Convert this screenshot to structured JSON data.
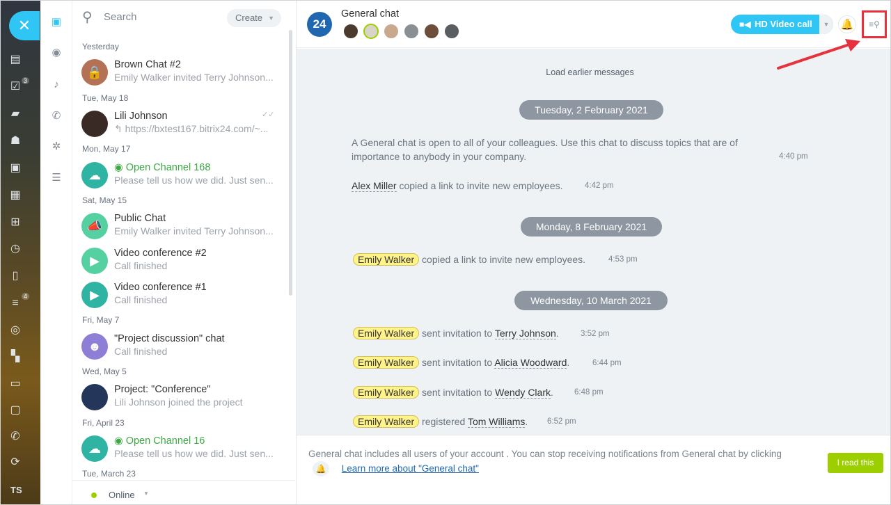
{
  "rail": {
    "close_glyph": "✕",
    "icons": [
      "feed-icon",
      "tasks-icon",
      "chat-icon",
      "employees-icon",
      "crm-icon",
      "calendar-icon",
      "shop-icon",
      "time-icon",
      "documents-icon",
      "filter-icon",
      "goals-icon",
      "apps-icon",
      "printer-icon",
      "window-icon",
      "phone-icon",
      "sync-icon"
    ],
    "badges": {
      "tasks": "3",
      "filter": "4"
    },
    "user_initials": "TS"
  },
  "iconcol": [
    "messages-icon",
    "openlines-icon",
    "notifications-icon",
    "calls-icon",
    "settings-icon",
    "tasks-list-icon"
  ],
  "search": {
    "placeholder": "Search",
    "create_label": "Create"
  },
  "recent": {
    "groups": [
      {
        "date": "Yesterday",
        "items": [
          {
            "title": "Brown Chat #2",
            "sub": "Emily Walker invited Terry Johnson..."
          }
        ]
      },
      {
        "date": "Tue, May 18",
        "items": [
          {
            "title": "Lili Johnson",
            "sub": "↰ https://bxtest167.bitrix24.com/~..."
          }
        ]
      },
      {
        "date": "Mon, May 17",
        "items": [
          {
            "title": "Open Channel 168",
            "sub": "Please tell us how we did. Just sen..."
          }
        ]
      },
      {
        "date": "Sat, May 15",
        "items": [
          {
            "title": "Public Chat",
            "sub": "Emily Walker invited Terry Johnson..."
          },
          {
            "title": "Video conference #2",
            "sub": "Call finished"
          },
          {
            "title": "Video conference #1",
            "sub": "Call finished"
          }
        ]
      },
      {
        "date": "Fri, May 7",
        "items": [
          {
            "title": "\"Project discussion\" chat",
            "sub": "Call finished"
          }
        ]
      },
      {
        "date": "Wed, May 5",
        "items": [
          {
            "title": "Project: \"Conference\"",
            "sub": "Lili Johnson joined the project"
          }
        ]
      },
      {
        "date": "Fri, April 23",
        "items": [
          {
            "title": "Open Channel 16",
            "sub": "Please tell us how we did. Just sen..."
          }
        ]
      },
      {
        "date": "Tue, March 23",
        "items": []
      }
    ]
  },
  "status": {
    "label": "Online"
  },
  "chat": {
    "avatar_text": "24",
    "title": "General chat",
    "video_label": "HD Video call",
    "load_earlier": "Load earlier messages",
    "dates": [
      "Tuesday, 2 February 2021",
      "Monday, 8 February 2021",
      "Wednesday, 10 March 2021"
    ],
    "intro": "A General chat is open to all of your colleagues. Use this chat to discuss topics that are of importance to anybody in your company.",
    "intro_time": "4:40 pm",
    "m1": {
      "name": "Alex Miller",
      "text": "copied a link to invite new employees.",
      "time": "4:42 pm"
    },
    "m2": {
      "name": "Emily Walker",
      "text": "copied a link to invite new employees.",
      "time": "4:53 pm"
    },
    "m3": {
      "name": "Emily Walker",
      "text": "sent invitation to",
      "target": "Terry Johnson",
      "time": "3:52 pm"
    },
    "m4": {
      "name": "Emily Walker",
      "text": "sent invitation to",
      "target": "Alicia Woodward",
      "time": "6:44 pm"
    },
    "m5": {
      "name": "Emily Walker",
      "text": "sent invitation to",
      "target": "Wendy Clark",
      "time": "6:48 pm"
    },
    "m6": {
      "name": "Emily Walker",
      "text": "registered",
      "target": "Tom Williams",
      "time": "6:52 pm"
    },
    "notice_text1": "General chat includes all users of your account . You can stop receiving notifications from General chat by clicking",
    "notice_link": "Learn more about \"General chat\"",
    "read_label": "I read this"
  },
  "colors": {
    "accent": "#2fc6f6",
    "highlight": "#e5323c",
    "read_button": "#9dcf00",
    "chat_bg": "#eef2f4"
  }
}
